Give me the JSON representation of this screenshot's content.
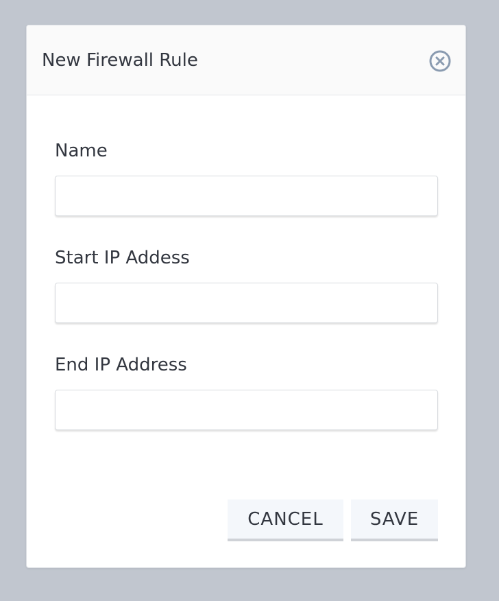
{
  "dialog": {
    "title": "New Firewall Rule",
    "close_icon": "close-circle-icon"
  },
  "form": {
    "fields": [
      {
        "label": "Name",
        "value": "",
        "placeholder": ""
      },
      {
        "label": "Start IP Addess",
        "value": "",
        "placeholder": ""
      },
      {
        "label": "End IP Address",
        "value": "",
        "placeholder": ""
      }
    ]
  },
  "actions": {
    "cancel_label": "CANCEL",
    "save_label": "SAVE"
  },
  "colors": {
    "backdrop": "#c1c6cf",
    "dialog_bg": "#ffffff",
    "header_bg": "#fafafa",
    "close_icon": "#8a9bb0",
    "button_bg": "#f4f7fb",
    "text": "#32363f"
  }
}
